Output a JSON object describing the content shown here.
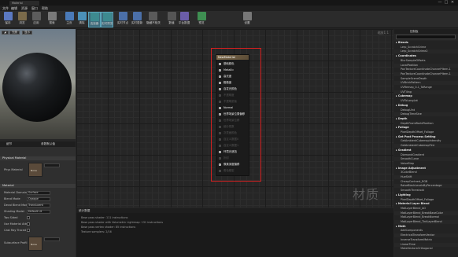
{
  "window": {
    "title_tab": "Material",
    "controls": [
      "—",
      "□",
      "✕"
    ]
  },
  "menu": [
    "文件",
    "编辑",
    "资源",
    "窗口",
    "帮助"
  ],
  "toolbar": [
    {
      "label": "保存",
      "icon": "save-icon",
      "color": "#5b79c2"
    },
    {
      "label": "浏览",
      "icon": "browse-icon",
      "color": "#7a6a4a"
    },
    {
      "label": "应用",
      "icon": "apply-icon",
      "color": "#5c5c5c"
    },
    {
      "label": "搜索",
      "icon": "search-icon",
      "color": "#7a7a7a"
    },
    {
      "label": "主页",
      "icon": "home-icon",
      "color": "#4a7ab8"
    },
    {
      "label": "清除",
      "icon": "clean-icon",
      "color": "#4b90b8"
    },
    {
      "label": "连接器",
      "icon": "connectors-icon",
      "color": "#3d8a8f",
      "active": true
    },
    {
      "label": "实时预览",
      "icon": "live-preview-icon",
      "color": "#3d8a8f",
      "active": true
    },
    {
      "label": "实时节点",
      "icon": "live-nodes-icon",
      "color": "#4b6fa8"
    },
    {
      "label": "实时更新",
      "icon": "live-update-icon",
      "color": "#4b6fa8"
    },
    {
      "label": "隐藏不相关",
      "icon": "hide-unrelated-icon",
      "color": "#5a5a5a"
    },
    {
      "label": "数值",
      "icon": "stats-icon",
      "color": "#555555"
    },
    {
      "label": "平台数据",
      "icon": "platform-stats-icon",
      "color": "#6a5da8"
    },
    {
      "label": "预览",
      "icon": "preview-icon",
      "color": "#3f8f52"
    },
    {
      "label": "设置",
      "icon": "settings-icon",
      "color": "#777777"
    }
  ],
  "preview": {
    "buttons": [
      "◢",
      "光照",
      "显示"
    ]
  },
  "details": {
    "tabs": [
      "细节",
      "参数默认值"
    ],
    "physical_section": "Physical Material",
    "phys_label": "Phys Material",
    "phys_value": "None",
    "material_section": "Material",
    "rows": [
      {
        "key": "Material Domain",
        "value": "Surface",
        "kind": "dropdown"
      },
      {
        "key": "Blend Mode",
        "value": "Opaque",
        "kind": "dropdown"
      },
      {
        "key": "Decal Blend Mode",
        "value": "Translucent",
        "kind": "dropdown"
      },
      {
        "key": "Shading Model",
        "value": "Default Lit",
        "kind": "dropdown"
      },
      {
        "key": "Two Sided",
        "value": "",
        "kind": "checkbox"
      },
      {
        "key": "Use Material Attr",
        "value": "",
        "kind": "checkbox"
      },
      {
        "key": "Cast Ray Traced",
        "value": "",
        "kind": "checkbox"
      }
    ],
    "subsurface_label": "Subsurface Profil",
    "subsurface_value": "None"
  },
  "graph": {
    "zoom": "缩放1:1",
    "watermark": "材质"
  },
  "node": {
    "title": "NewMaterial",
    "pins": [
      {
        "label": "基础颜色",
        "active": true
      },
      {
        "label": "Metallic",
        "active": true
      },
      {
        "label": "高光度",
        "active": true
      },
      {
        "label": "粗糙度",
        "active": true
      },
      {
        "label": "自发光颜色",
        "active": true
      },
      {
        "label": "不透明度",
        "active": false
      },
      {
        "label": "不透明蒙版",
        "active": false
      },
      {
        "label": "Normal",
        "active": true
      },
      {
        "label": "世界场景位置偏移",
        "active": true
      },
      {
        "label": "世界场景位移",
        "active": false
      },
      {
        "label": "细分乘数",
        "active": false
      },
      {
        "label": "次表面颜色",
        "active": false
      },
      {
        "label": "自定义数据0",
        "active": false
      },
      {
        "label": "自定义数据1",
        "active": false
      },
      {
        "label": "环境光遮挡",
        "active": true
      },
      {
        "label": "折射",
        "active": false
      },
      {
        "label": "像素深度偏移",
        "active": true
      },
      {
        "label": "着色模型",
        "active": false
      }
    ]
  },
  "stats": {
    "tab": "统计数据",
    "lines": [
      "Base pass shader: 111 instructions",
      "Base pass shader with Volumetric Lightmap: 131 instructions",
      "Base pass vertex shader: 85 instructions",
      "Texture samplers: 2/16"
    ]
  },
  "palette": {
    "tab": "控制板",
    "items": [
      {
        "t": "Blends",
        "c": true
      },
      {
        "t": "Lerp_ScratchGrime",
        "c": false
      },
      {
        "t": "Lerp_ScratchGrime2",
        "c": false
      },
      {
        "t": "Coordinates",
        "c": true
      },
      {
        "t": "BlurSampleOffsets",
        "c": false
      },
      {
        "t": "LocalPosition",
        "c": false
      },
      {
        "t": "PanTextureCoordinateChannel*Item-1",
        "c": false
      },
      {
        "t": "PanTextureCoordinateChannel*Item-1",
        "c": false
      },
      {
        "t": "SampleSceneDepth",
        "c": false
      },
      {
        "t": "UVBrickPattern",
        "c": false
      },
      {
        "t": "UVRemap_0-1_ToRange",
        "c": false
      },
      {
        "t": "UVTiling",
        "c": false
      },
      {
        "t": "Cubemap",
        "c": true
      },
      {
        "t": "UVToLongLat",
        "c": false
      },
      {
        "t": "Debug",
        "c": true
      },
      {
        "t": "DebugUInt",
        "c": false
      },
      {
        "t": "DebugTimeSine",
        "c": false
      },
      {
        "t": "Depth",
        "c": true
      },
      {
        "t": "DepthFromWorldPosition",
        "c": false
      },
      {
        "t": "Foliage",
        "c": true
      },
      {
        "t": "PixelDepthOffset_Foliage",
        "c": false
      },
      {
        "t": "Get Post Process Setting",
        "c": true
      },
      {
        "t": "GetAmbientCubemapIntensity",
        "c": false
      },
      {
        "t": "GetAmbientCubemapTint",
        "c": false
      },
      {
        "t": "Gradient",
        "c": true
      },
      {
        "t": "DiamondGradient",
        "c": false
      },
      {
        "t": "SmoothCurve",
        "c": false
      },
      {
        "t": "ValueStep",
        "c": false
      },
      {
        "t": "Image Adjustment",
        "c": true
      },
      {
        "t": "3ColorBlend",
        "c": false
      },
      {
        "t": "HueShift",
        "c": false
      },
      {
        "t": "CheapContrast_RGB",
        "c": false
      },
      {
        "t": "RaiseBlackLevelsByPercentage",
        "c": false
      },
      {
        "t": "SmoothThreshold",
        "c": false
      },
      {
        "t": "Lighting",
        "c": true
      },
      {
        "t": "PixelDepthOffset_Foliage",
        "c": false
      },
      {
        "t": "Material Layer Blend",
        "c": true
      },
      {
        "t": "MatLayerBlend_AO",
        "c": false
      },
      {
        "t": "MatLayerBlend_BreakBaseColor",
        "c": false
      },
      {
        "t": "MatLayerBlend_BreakNormal",
        "c": false
      },
      {
        "t": "MatLayerBlend_TintLayerBlend",
        "c": false
      },
      {
        "t": "Math",
        "c": true
      },
      {
        "t": "AddComponents",
        "c": false
      },
      {
        "t": "ElectricalTransformVector",
        "c": false
      },
      {
        "t": "InverseTransformMatrix",
        "c": false
      },
      {
        "t": "LinearTime",
        "c": false
      },
      {
        "t": "MakeVectorsOrthogonal",
        "c": false
      }
    ]
  }
}
